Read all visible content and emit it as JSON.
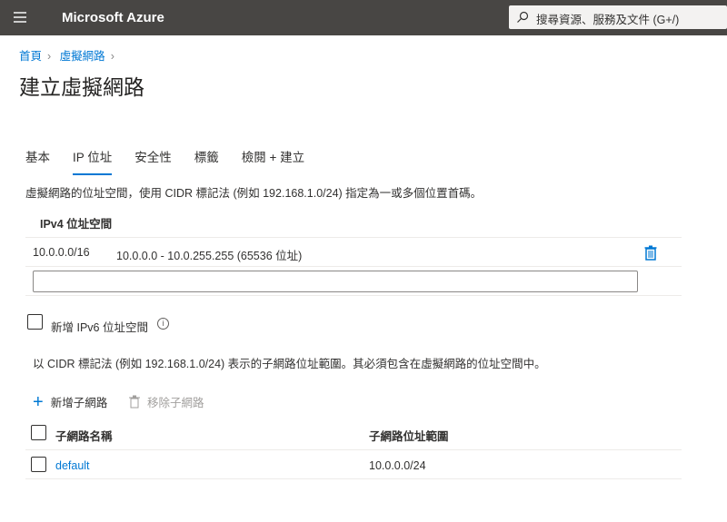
{
  "header": {
    "brand": "Microsoft Azure",
    "search_placeholder": "搜尋資源、服務及文件 (G+/)"
  },
  "breadcrumb": [
    "首頁",
    "虛擬網路"
  ],
  "page_title": "建立虛擬網路",
  "tabs": [
    "基本",
    "IP 位址",
    "安全性",
    "標籤",
    "檢閱 + 建立"
  ],
  "active_tab": "IP 位址",
  "address_space": {
    "description": "虛擬網路的位址空間，使用 CIDR 標記法 (例如 192.168.1.0/24) 指定為一或多個位置首碼。",
    "header": "IPv4 位址空間",
    "rows": [
      {
        "cidr": "10.0.0.0/16",
        "range": "10.0.0.0 - 10.0.255.255 (65536 位址)"
      }
    ],
    "new_value": ""
  },
  "ipv6_label": "新增 IPv6 位址空間",
  "subnet_description": "以 CIDR 標記法 (例如 192.168.1.0/24) 表示的子網路位址範圍。其必須包含在虛擬網路的位址空間中。",
  "subnet_toolbar": {
    "add": "新增子網路",
    "remove": "移除子網路"
  },
  "subnet_table": {
    "columns": [
      "子網路名稱",
      "子網路位址範圍"
    ],
    "rows": [
      {
        "name": "default",
        "range": "10.0.0.0/24"
      }
    ]
  }
}
